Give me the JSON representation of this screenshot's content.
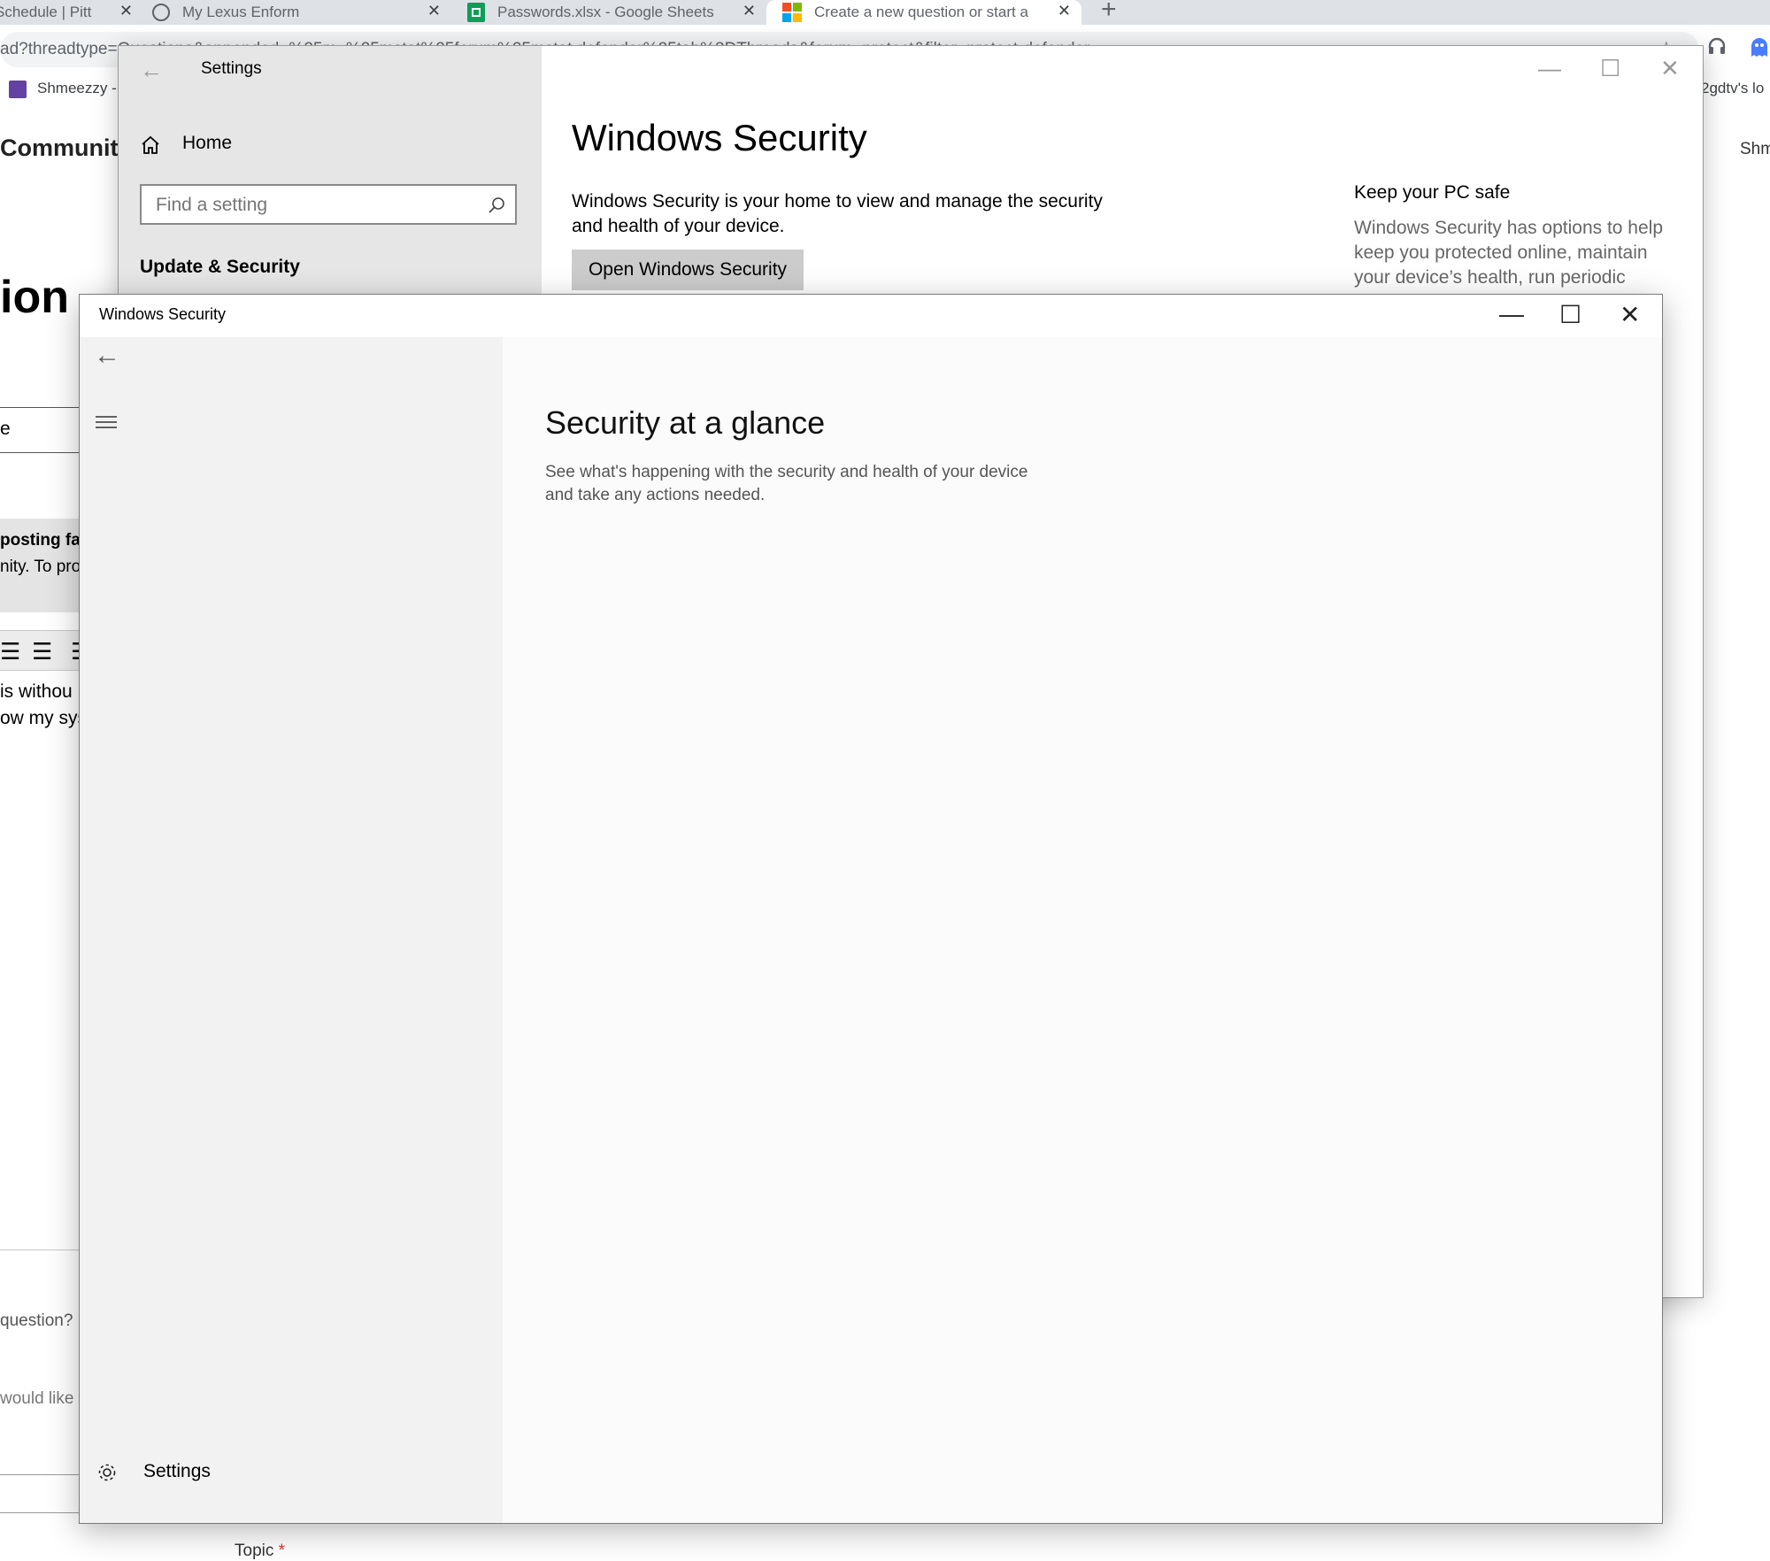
{
  "browser": {
    "tabs": [
      {
        "label": "Schedule | Pitt"
      },
      {
        "label": "My Lexus Enform"
      },
      {
        "label": "Passwords.xlsx - Google Sheets"
      },
      {
        "label": "Create a new question or start a"
      }
    ],
    "tab_close_glyph": "✕",
    "new_tab_glyph": "+",
    "address_text": "ad?threadtype=Questions&appended=%25m..%25mstat%25forum%25mstat.defender%25tab%3DThreads&forum=protect&filter=protect-defender",
    "bookmarks": [
      {
        "label": "Shmeezzy -"
      },
      {
        "label": "2gdtv's lo"
      }
    ],
    "page_fragments": {
      "community": "Community",
      "heading_ion": "ion",
      "input_e": "e",
      "notice_bold": "posting fak",
      "notice_text": "nity. To pro",
      "body_line1": "is withou",
      "body_line2": "ow my sys",
      "question_label": "question? I",
      "would_like": "would like",
      "topic_label": "Topic",
      "required_star": "*",
      "user_short": "Shm"
    }
  },
  "settings_window": {
    "title": "Settings",
    "back_glyph": "←",
    "minimize_glyph": "—",
    "maximize_glyph": "☐",
    "close_glyph": "✕",
    "home_label": "Home",
    "search_placeholder": "Find a setting",
    "section_label": "Update & Security",
    "page_title": "Windows Security",
    "description": "Windows Security is your home to view and manage the security and health of your device.",
    "open_button_label": "Open Windows Security",
    "side_heading": "Keep your PC safe",
    "side_text": "Windows Security has options to help keep you protected online, maintain your device’s health, run periodic"
  },
  "security_window": {
    "title": "Windows Security",
    "back_glyph": "←",
    "menu_glyph": "≡",
    "minimize_glyph": "—",
    "maximize_glyph": "☐",
    "close_glyph": "✕",
    "heading": "Security at a glance",
    "subtitle": "See what's happening with the security and health of your device and take any actions needed.",
    "settings_label": "Settings"
  },
  "colors": {
    "twitch": "#6441a5",
    "sheets_green": "#0f9d58",
    "ms_red": "#f25022",
    "ms_green": "#7fba00",
    "ms_blue": "#00a4ef",
    "ms_yellow": "#ffb900",
    "required_red": "#d13438"
  },
  "icons": [
    "home-icon",
    "search-icon",
    "back-arrow-icon",
    "hamburger-menu-icon",
    "gear-icon",
    "headphones-icon",
    "extension-icon",
    "star-icon"
  ]
}
